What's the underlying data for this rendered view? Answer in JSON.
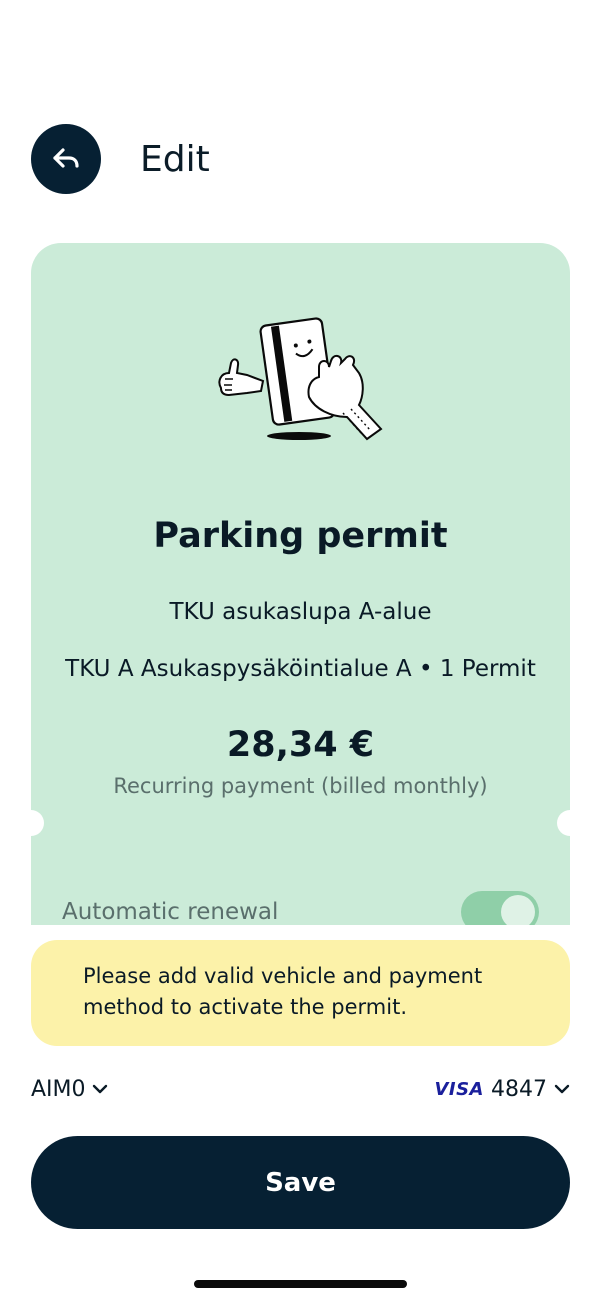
{
  "header": {
    "title": "Edit",
    "back_icon": "reply-arrow-icon"
  },
  "permit": {
    "title": "Parking permit",
    "name": "TKU asukaslupa A-alue",
    "area": "TKU A Asukaspysäköintialue A • 1 Permit",
    "price": "28,34 €",
    "billing": "Recurring payment (billed monthly)",
    "renewal_label": "Automatic renewal",
    "renewal_enabled": true
  },
  "warning": {
    "text": "Please add valid vehicle and payment method to activate the permit."
  },
  "vehicle": {
    "plate": "AIM0"
  },
  "payment": {
    "brand": "VISA",
    "last4": "4847"
  },
  "actions": {
    "save_label": "Save"
  },
  "colors": {
    "card_background": "#cbebd8",
    "primary_dark": "#062033",
    "warning_background": "#fcf2a9",
    "toggle_on": "#8fcfa8",
    "visa_blue": "#1a1f9c"
  }
}
